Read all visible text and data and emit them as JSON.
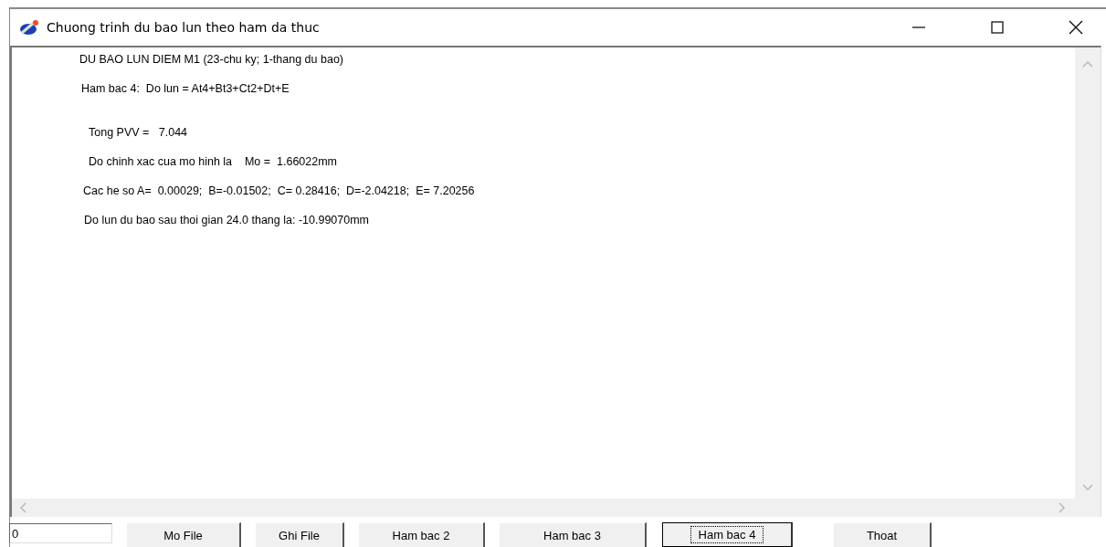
{
  "window": {
    "title": "Chuong trinh du bao lun theo ham da thuc"
  },
  "output_lines": [
    "DU BAO LUN DIEM M1 (23-chu ky; 1-thang du bao)",
    "Ham bac 4:  Do lun = At4+Bt3+Ct2+Dt+E",
    "Tong PVV =   7.044",
    "Do chinh xac cua mo hinh la    Mo =  1.66022mm",
    "Cac he so A=  0.00029;  B=-0.01502;  C= 0.28416;  D=-2.04218;  E= 7.20256",
    "Do lun du bao sau thoi gian 24.0 thang la: -10.99070mm"
  ],
  "input": {
    "value": "0"
  },
  "buttons": [
    {
      "label": "Mo File",
      "focused": false
    },
    {
      "label": "Ghi File",
      "focused": false
    },
    {
      "label": "Ham bac 2",
      "focused": false
    },
    {
      "label": "Ham bac 3",
      "focused": false
    },
    {
      "label": "Ham bac 4",
      "focused": true
    },
    {
      "label": "Thoat",
      "focused": false
    }
  ]
}
